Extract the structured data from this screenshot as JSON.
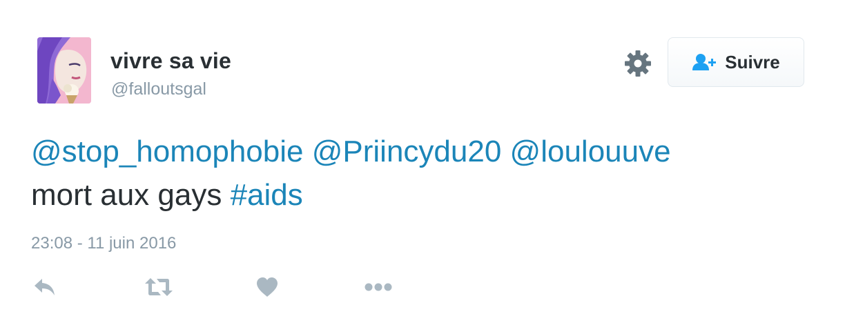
{
  "user": {
    "fullname": "vivre sa vie",
    "screen_name": "@falloutsgal"
  },
  "follow_button": {
    "label": "Suivre"
  },
  "tweet": {
    "mentions": [
      "@stop_homophobie",
      "@Priincydu20",
      "@loulouuve"
    ],
    "text": "mort aux gays",
    "hashtag": "#aids",
    "timestamp": "23:08 - 11 juin 2016"
  },
  "icons": {
    "settings": "gear-icon",
    "follow": "follow-user-icon",
    "reply": "reply-icon",
    "retweet": "retweet-icon",
    "like": "heart-icon",
    "more": "more-icon"
  },
  "colors": {
    "link": "#1b85b8",
    "text": "#292f33",
    "muted": "#8899a6",
    "icon": "#aab8c2",
    "gear": "#66757f",
    "follow_icon": "#1da1f2"
  }
}
